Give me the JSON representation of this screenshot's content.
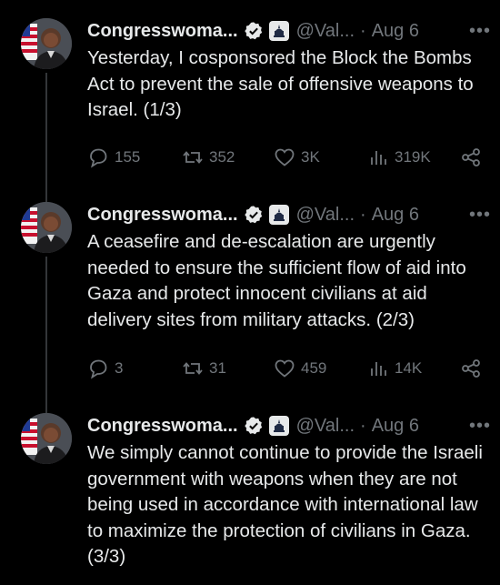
{
  "tweets": [
    {
      "name": "Congresswoma...",
      "handle": "@Val...",
      "date": "Aug 6",
      "text": "Yesterday, I cosponsored the Block the Bombs Act to prevent the sale of offensive weapons to Israel. (1/3)",
      "replies": "155",
      "reposts": "352",
      "likes": "3K",
      "views": "319K"
    },
    {
      "name": "Congresswoma...",
      "handle": "@Val...",
      "date": "Aug 6",
      "text": "A ceasefire and de-escalation are urgently needed to ensure the sufficient flow of aid into Gaza and protect innocent civilians at aid delivery sites from military attacks. (2/3)",
      "replies": "3",
      "reposts": "31",
      "likes": "459",
      "views": "14K"
    },
    {
      "name": "Congresswoma...",
      "handle": "@Val...",
      "date": "Aug 6",
      "text": "We simply cannot continue to provide the Israeli government with weapons when they are not being used in accordance with international law to maximize the protection of civilians in Gaza. (3/3)"
    }
  ],
  "separator": "·",
  "more": "•••",
  "colors": {
    "background": "#000000",
    "text": "#e7e9ea",
    "muted": "#71767b",
    "verified": "#1d9bf0",
    "thread": "#333639"
  },
  "icons": [
    "verified-badge-icon",
    "government-affiliation-icon",
    "reply-icon",
    "repost-icon",
    "like-icon",
    "views-icon",
    "share-icon",
    "more-icon"
  ]
}
